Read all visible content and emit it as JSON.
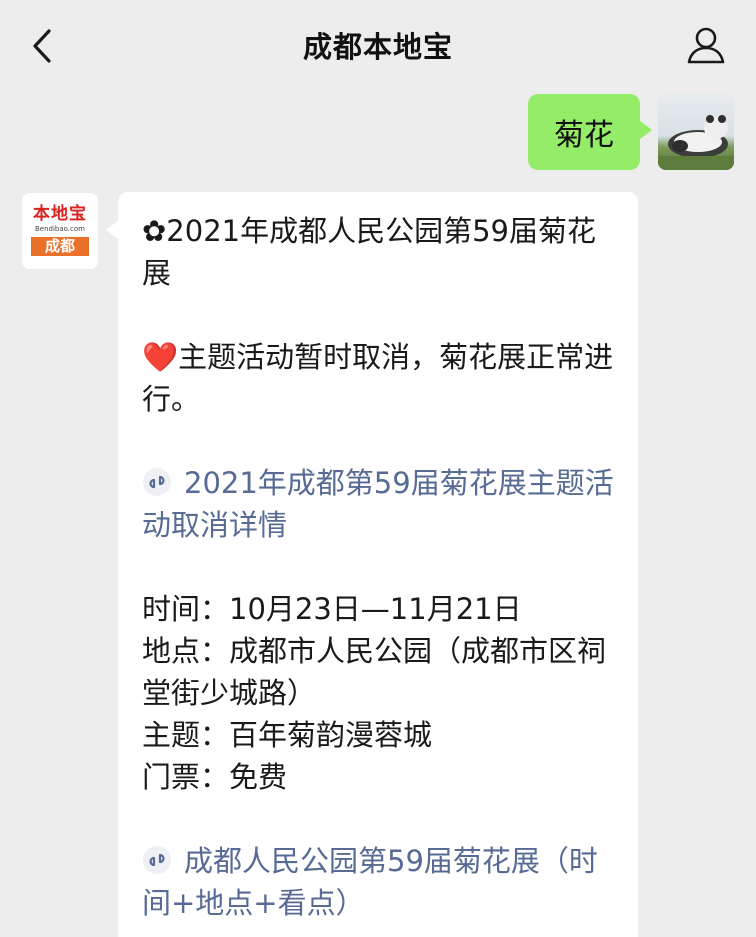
{
  "header": {
    "title": "成都本地宝"
  },
  "outgoing": {
    "text": "菊花"
  },
  "bot_avatar": {
    "logo_text": "本地宝",
    "logo_sub": "Bendibao.com",
    "logo_city": "成都"
  },
  "message": {
    "line1": "✿2021年成都人民公园第59届菊花展",
    "line2": "❤️主题活动暂时取消，菊花展正常进行。",
    "link1": "2021年成都第59届菊花展主题活动取消详情",
    "time": "时间：10月23日—11月21日",
    "place": "地点：成都市人民公园（成都市区祠堂街少城路）",
    "theme": "主题：百年菊韵漫蓉城",
    "ticket": "门票：免费",
    "link2": "成都人民公园第59届菊花展（时间+地点+看点）"
  },
  "colors": {
    "bubble_out": "#95ec69",
    "link": "#576b95",
    "background": "#ededed",
    "logo_red": "#d8231f",
    "logo_orange": "#e9712a"
  },
  "icons": {
    "back": "chevron-left-icon",
    "profile": "person-icon",
    "mini_program": "mini-program-icon"
  }
}
